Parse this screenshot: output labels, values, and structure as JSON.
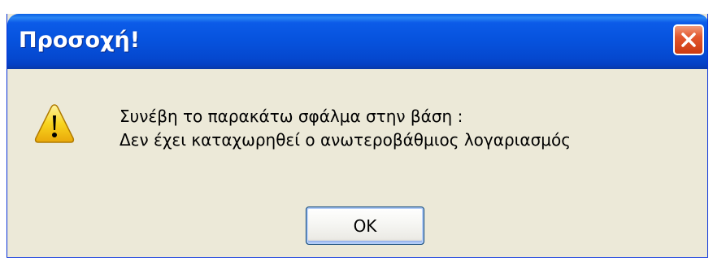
{
  "dialog": {
    "title": "Προσοχή!",
    "close_icon": "close-icon",
    "warning_icon": "warning-icon",
    "message_line1": "Συνέβη το παρακάτω σφάλμα στην βάση :",
    "message_line2": "Δεν έχει καταχωρηθεί ο ανωτεροβάθμιος λογαριασμός",
    "ok_label": "OK"
  },
  "colors": {
    "titlebar": "#0652dd",
    "body": "#ece9d8",
    "close_button": "#e2572e",
    "warning_yellow": "#f8d41e"
  }
}
